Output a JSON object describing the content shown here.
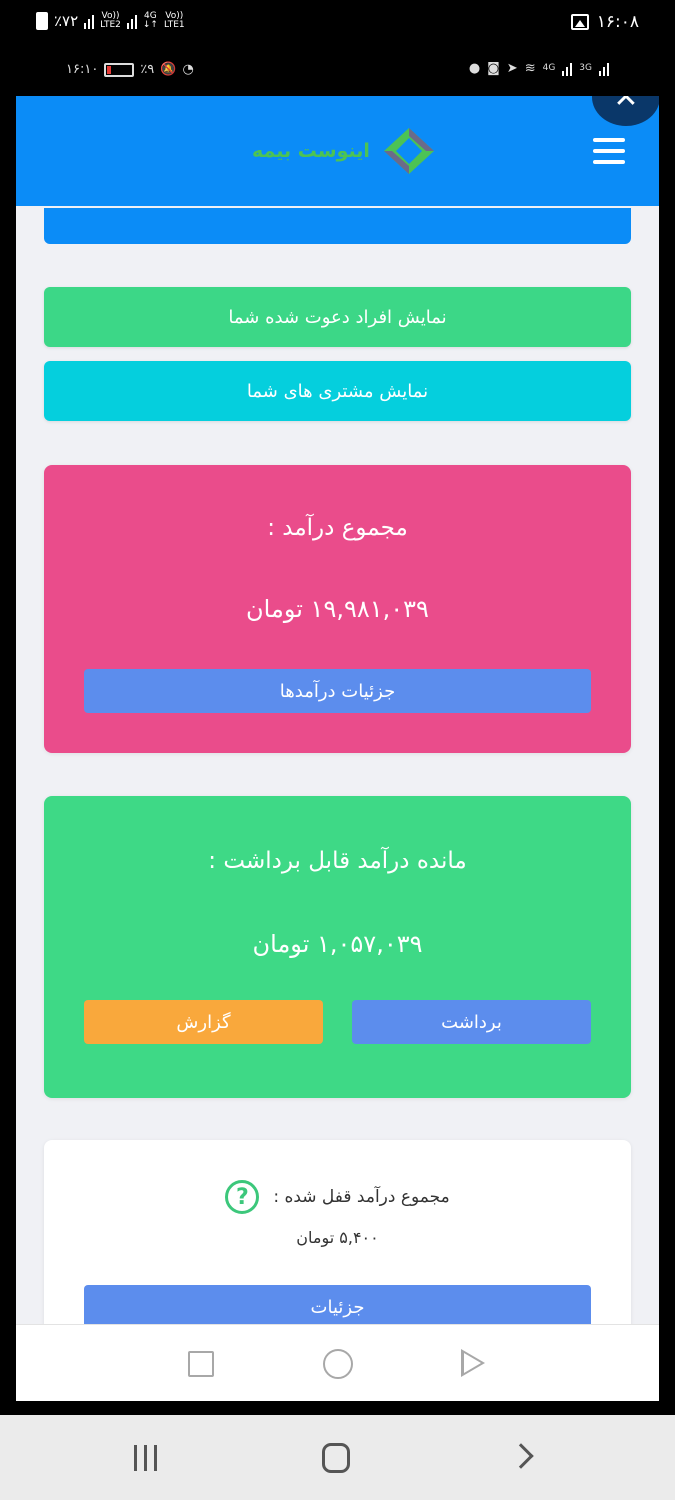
{
  "status_bar": {
    "battery_percent": "٪۷۲",
    "net_volte_1": "Vo))",
    "net_lte2": "LTE2",
    "net_4g": "4G",
    "net_arrows": "↓↑",
    "net_volte_2": "Vo))",
    "net_lte1": "LTE1",
    "time": "۱۶:۰۸"
  },
  "inner_status_bar": {
    "time": "۱۶:۱۰",
    "battery_percent": "٪۹",
    "net_4g": "4G",
    "net_3g": "3G"
  },
  "header": {
    "logo_text": "اینوست بیمه",
    "close_symbol": "✕"
  },
  "buttons": {
    "invites": "نمایش افراد دعوت شده شما",
    "customers": "نمایش مشتری های شما"
  },
  "income_total": {
    "title": "مجموع درآمد :",
    "amount": "۱۹,۹۸۱,۰۳۹ تومان",
    "details_button": "جزئیات درآمدها"
  },
  "withdrawable": {
    "title": "مانده درآمد قابل برداشت :",
    "amount": "۱,۰۵۷,۰۳۹ تومان",
    "withdraw_button": "برداشت",
    "report_button": "گزارش"
  },
  "locked": {
    "label": "مجموع درآمد قفل شده :",
    "amount": "۵,۴۰۰ تومان",
    "help_symbol": "?",
    "details_button": "جزئیات"
  },
  "colors": {
    "header": "#0b8cf7",
    "green_button": "#3cd787",
    "cyan_button": "#05cfdd",
    "pink_card": "#ea4c8b",
    "green_card": "#3ed986",
    "blue_pill": "#5c8ded",
    "orange_pill": "#f9a83c"
  },
  "icons": [
    "battery-icon",
    "signal-icon",
    "image-icon",
    "menu-icon",
    "logo-icon",
    "close-icon",
    "help-icon",
    "square-icon",
    "circle-icon",
    "play-icon",
    "recent-apps-icon",
    "home-icon",
    "back-icon"
  ]
}
